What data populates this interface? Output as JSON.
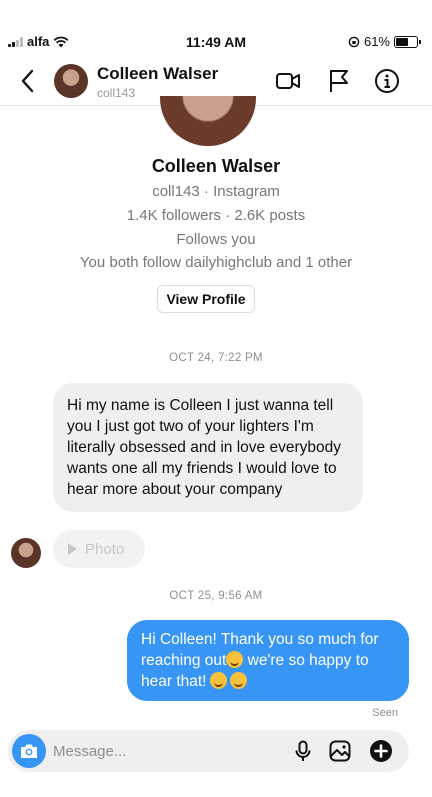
{
  "status": {
    "carrier": "alfa",
    "time": "11:49 AM",
    "battery": "61%",
    "battery_level": 0.61
  },
  "header": {
    "name": "Colleen Walser",
    "username": "coll143"
  },
  "profile": {
    "name": "Colleen Walser",
    "subtitle": "coll143 · Instagram",
    "stats": "1.4K followers · 2.6K posts",
    "follows": "Follows you",
    "mutual": "You both follow dailyhighclub and 1 other",
    "view_profile_label": "View Profile"
  },
  "thread": {
    "ts1": "OCT 24, 7:22 PM",
    "incoming_message": "Hi my name is Colleen I just wanna tell you I just got two of your lighters I'm literally obsessed and in love everybody wants one all my friends I would love to hear more about your company",
    "photo_label": "Photo",
    "ts2": "OCT 25, 9:56 AM",
    "outgoing_part1": "Hi Colleen! Thank you so much for reaching out",
    "outgoing_part2": " we're so happy to hear that!",
    "seen": "Seen"
  },
  "composer": {
    "placeholder": "Message..."
  },
  "colors": {
    "accent_blue": "#3796f5",
    "incoming_bubble": "#efefef"
  }
}
